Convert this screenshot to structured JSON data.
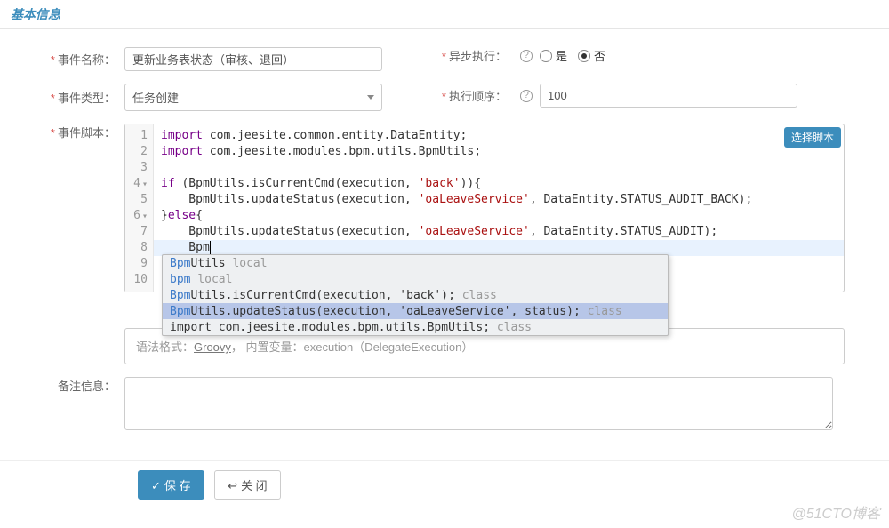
{
  "tab_title": "基本信息",
  "labels": {
    "event_name": "事件名称：",
    "async_exec": "异步执行：",
    "event_type": "事件类型：",
    "exec_order": "执行顺序：",
    "event_script": "事件脚本：",
    "remark": "备注信息："
  },
  "event_name_value": "更新业务表状态（审核、退回）",
  "event_type_value": "任务创建",
  "exec_order_value": "100",
  "radio": {
    "yes": "是",
    "no": "否"
  },
  "select_script": "选择脚本",
  "gutter": [
    "1",
    "2",
    "3",
    "4",
    "5",
    "6",
    "7",
    "8",
    "9",
    "10"
  ],
  "code": {
    "l1_a": "import",
    "l1_b": " com.jeesite.common.entity.DataEntity;",
    "l2_a": "import",
    "l2_b": " com.jeesite.modules.bpm.utils.BpmUtils;",
    "l4_a": "if",
    "l4_b": " (BpmUtils.isCurrentCmd(execution, ",
    "l4_c": "'back'",
    "l4_d": ")){",
    "l5_a": "    BpmUtils.updateStatus(execution, ",
    "l5_b": "'oaLeaveService'",
    "l5_c": ", DataEntity.STATUS_AUDIT_BACK);",
    "l6_a": "}",
    "l6_b": "else",
    "l6_c": "{",
    "l7_a": "    BpmUtils.updateStatus(execution, ",
    "l7_b": "'oaLeaveService'",
    "l7_c": ", DataEntity.STATUS_AUDIT);",
    "l8": "    Bpm",
    "l9": "}"
  },
  "ac": [
    {
      "name": "Bpm",
      "rest": "Utils  ",
      "type": "local"
    },
    {
      "name": "bpm",
      "rest": "  ",
      "type": "local"
    },
    {
      "name": "Bpm",
      "rest": "Utils.isCurrentCmd(execution, 'back');  ",
      "type": "class"
    },
    {
      "name": "Bpm",
      "rest": "Utils.updateStatus(execution, 'oaLeaveService', status);  ",
      "type": "class"
    },
    {
      "name": "",
      "rest": "import com.jeesite.modules.bpm.utils.BpmUtils;  ",
      "type": "class"
    }
  ],
  "hint": {
    "prefix": "语法格式：",
    "lang": "Groovy",
    "sep": "，  内置变量：execution（DelegateExecution）"
  },
  "buttons": {
    "save": "保 存",
    "close": "关 闭"
  },
  "watermark": "@51CTO博客"
}
